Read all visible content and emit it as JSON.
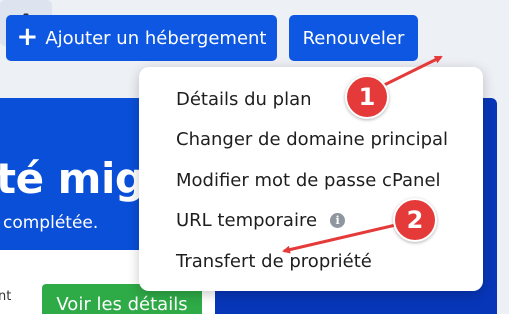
{
  "toolbar": {
    "add_icon": "+",
    "add_label": "Ajouter un hébergement",
    "renew_label": "Renouveler",
    "settings_icon": "gear-icon"
  },
  "banner": {
    "title": "té migrc",
    "subtitle": "complétée."
  },
  "lower": {
    "cut_text": "nt",
    "details_button": "Voir les détails"
  },
  "menu": {
    "items": [
      {
        "label": "Détails du plan"
      },
      {
        "label": "Changer de domaine principal"
      },
      {
        "label": "Modifier mot de passe cPanel"
      },
      {
        "label": "URL temporaire",
        "info_icon": "i"
      },
      {
        "label": "Transfert de propriété"
      }
    ]
  },
  "annotations": {
    "badge_1": "1",
    "badge_2": "2",
    "color": "#e53a3a"
  },
  "colors": {
    "primary": "#0d57e3",
    "banner": "#0a4fd8",
    "success": "#2eaa47"
  }
}
